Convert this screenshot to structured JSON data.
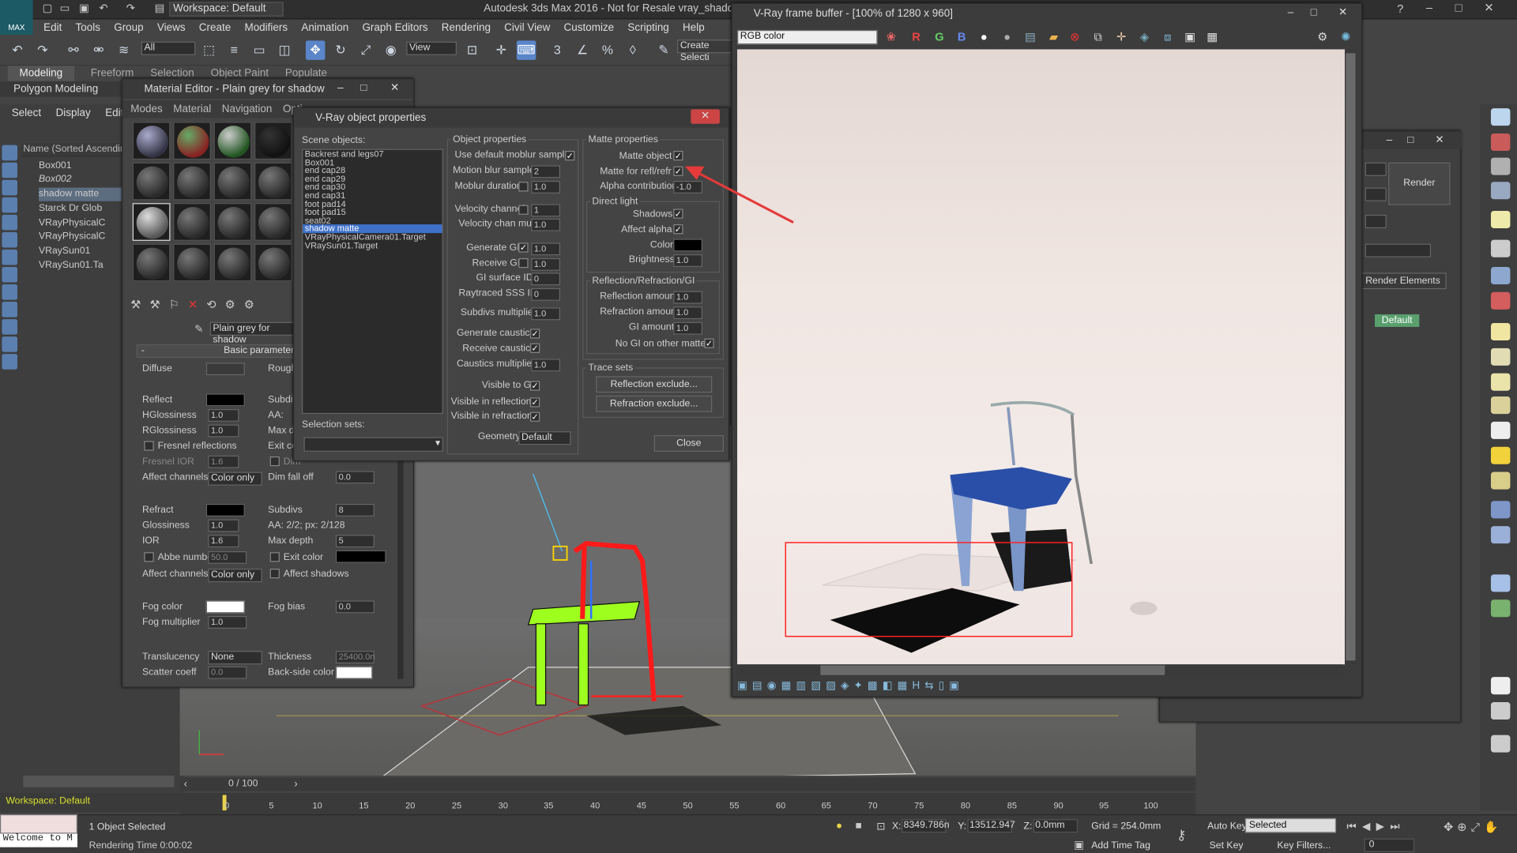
{
  "app": {
    "title": "Autodesk 3ds Max 2016 - Not for Resale    vray_shadow_ma",
    "logo": "MAX",
    "workspace": "Workspace: Default",
    "menus": [
      "Edit",
      "Tools",
      "Group",
      "Views",
      "Create",
      "Modifiers",
      "Animation",
      "Graph Editors",
      "Rendering",
      "Civil View",
      "Customize",
      "Scripting",
      "Help"
    ],
    "selection_filter": "All",
    "ref_coord": "View",
    "named_sel": "Create Selecti",
    "ribbon_tabs": [
      "Modeling",
      "Freeform",
      "Selection",
      "Object Paint",
      "Populate"
    ],
    "ribbon_sub": "Polygon Modeling"
  },
  "scene_explorer": {
    "tabs": [
      "Select",
      "Display",
      "Edit"
    ],
    "header": "Name (Sorted Ascending)",
    "items": [
      "Box001",
      "Box002",
      "shadow matte",
      "Starck Dr Glob",
      "VRayPhysicalC",
      "VRayPhysicalC",
      "VRaySun01",
      "VRaySun01.Ta"
    ],
    "workspace_label": "Workspace: Default"
  },
  "material_editor": {
    "title": "Material Editor - Plain grey for shadow",
    "menus": [
      "Modes",
      "Material",
      "Navigation",
      "Opti"
    ],
    "material_name": "Plain grey for shadow",
    "rollout": "Basic parameter",
    "params": {
      "diffuse": "Diffuse",
      "rough": "Rough",
      "reflect": "Reflect",
      "subdivs": "Subdiv",
      "hglossiness": "HGlossiness",
      "hglossiness_val": "1.0",
      "rglossiness": "RGlossiness",
      "rglossiness_val": "1.0",
      "fresnel": "Fresnel reflections",
      "fresnel_ior": "Fresnel IOR",
      "fresnel_ior_val": "1.6",
      "aa": "AA:",
      "maxd": "Max de",
      "exitc": "Exit co",
      "dim": "Dim",
      "affect_channels": "Affect channels",
      "affect_val": "Color only",
      "dim_falloff": "Dim fall off",
      "dim_falloff_val": "0.0",
      "refract": "Refract",
      "refract_subdivs": "Subdivs",
      "refract_subdivs_val": "8",
      "glossiness": "Glossiness",
      "glossiness_val": "1.0",
      "refract_aa": "AA: 2/2; px: 2/128",
      "ior": "IOR",
      "ior_val": "1.6",
      "max_depth": "Max depth",
      "max_depth_val": "5",
      "abbe": "Abbe number",
      "abbe_val": "50.0",
      "exit_color": "Exit color",
      "affect_channels2": "Affect channels",
      "affect_val2": "Color only",
      "affect_shadows": "Affect shadows",
      "fog_color": "Fog color",
      "fog_bias": "Fog bias",
      "fog_bias_val": "0.0",
      "fog_mult": "Fog multiplier",
      "fog_mult_val": "1.0",
      "translucency": "Translucency",
      "transl_val": "None",
      "thickness": "Thickness",
      "thickness_val": "25400.0n",
      "scatter": "Scatter coeff",
      "scatter_val": "0.0",
      "backside": "Back-side color"
    }
  },
  "vray_props": {
    "title": "V-Ray object properties",
    "scene_objects_label": "Scene objects:",
    "scene_objects": [
      "Backrest and legs07",
      "Box001",
      "end cap28",
      "end cap29",
      "end cap30",
      "end cap31",
      "foot pad14",
      "foot pad15",
      "seat02",
      "shadow matte",
      "VRayPhysicalCamera01.Target",
      "VRaySun01.Target"
    ],
    "selected_index": 9,
    "selection_sets_label": "Selection sets:",
    "object_properties": {
      "title": "Object properties",
      "use_default_moblur": "Use default moblur samples",
      "motion_blur_samples": "Motion blur samples",
      "mbs_val": "2",
      "moblur_duration": "Moblur duration",
      "mbd_val": "1.0",
      "velocity_channel": "Velocity channel",
      "vc_val": "1",
      "velocity_chan_mult": "Velocity chan mult",
      "vcm_val": "1.0",
      "generate_gi": "Generate GI",
      "ggi_val": "1.0",
      "receive_gi": "Receive GI",
      "rgi_val": "1.0",
      "gi_surface_id": "GI surface ID",
      "gsi_val": "0",
      "raytraced_sss_id": "Raytraced SSS ID",
      "rsi_val": "0",
      "subdivs_multiplier": "Subdivs multiplier",
      "sm_val": "1.0",
      "generate_caustics": "Generate caustics",
      "receive_caustics": "Receive caustics",
      "caustics_multiplier": "Caustics multiplier",
      "cm_val": "1.0",
      "visible_to_gi": "Visible to GI",
      "visible_in_reflections": "Visible in reflections",
      "visible_in_refractions": "Visible in refractions",
      "geometry": "Geometry",
      "geometry_val": "Default"
    },
    "matte_properties": {
      "title": "Matte properties",
      "matte_object": "Matte object",
      "matte_refl": "Matte for refl/refr",
      "alpha_contribution": "Alpha contribution",
      "alpha_val": "-1.0",
      "direct_light": "Direct light",
      "shadows": "Shadows",
      "affect_alpha": "Affect alpha",
      "color": "Color",
      "brightness": "Brightness",
      "brightness_val": "1.0",
      "rrgi": "Reflection/Refraction/GI",
      "reflection_amount": "Reflection amount",
      "ra_val": "1.0",
      "refraction_amount": "Refraction amount",
      "rfa_val": "1.0",
      "gi_amount": "GI amount",
      "gia_val": "1.0",
      "no_gi": "No GI on other mattes"
    },
    "trace_sets": "Trace sets",
    "reflection_exclude": "Reflection exclude...",
    "refraction_exclude": "Refraction exclude...",
    "close": "Close"
  },
  "frame_buffer": {
    "title": "V-Ray frame buffer - [100% of 1280 x 960]",
    "channel": "RGB color",
    "channels": [
      "R",
      "G",
      "B"
    ]
  },
  "render_setup": {
    "render": "Render",
    "render_elements": "Render Elements",
    "default": "Default"
  },
  "timeline": {
    "frame": "0 / 100",
    "ticks": [
      "0",
      "5",
      "10",
      "15",
      "20",
      "25",
      "30",
      "35",
      "40",
      "45",
      "50",
      "55",
      "60",
      "65",
      "70",
      "75",
      "80",
      "85",
      "90",
      "95",
      "100"
    ]
  },
  "status": {
    "listener": "Welcome to M",
    "objects_selected": "1 Object Selected",
    "rendering_time": "Rendering Time  0:00:02",
    "x_label": "X:",
    "x": "8349.786n",
    "y_label": "Y:",
    "y": "13512.947",
    "z_label": "Z:",
    "z": "0.0mm",
    "grid": "Grid = 254.0mm",
    "add_time_tag": "Add Time Tag",
    "auto_key": "Auto Key",
    "set_key": "Set Key",
    "selected": "Selected",
    "key_filters": "Key Filters...",
    "frame_field": "0"
  },
  "colors": {
    "accent": "#3f71c9",
    "arrow": "#e53a3a",
    "selection": "#ff2020",
    "chair_seat": "#9eff1f"
  }
}
